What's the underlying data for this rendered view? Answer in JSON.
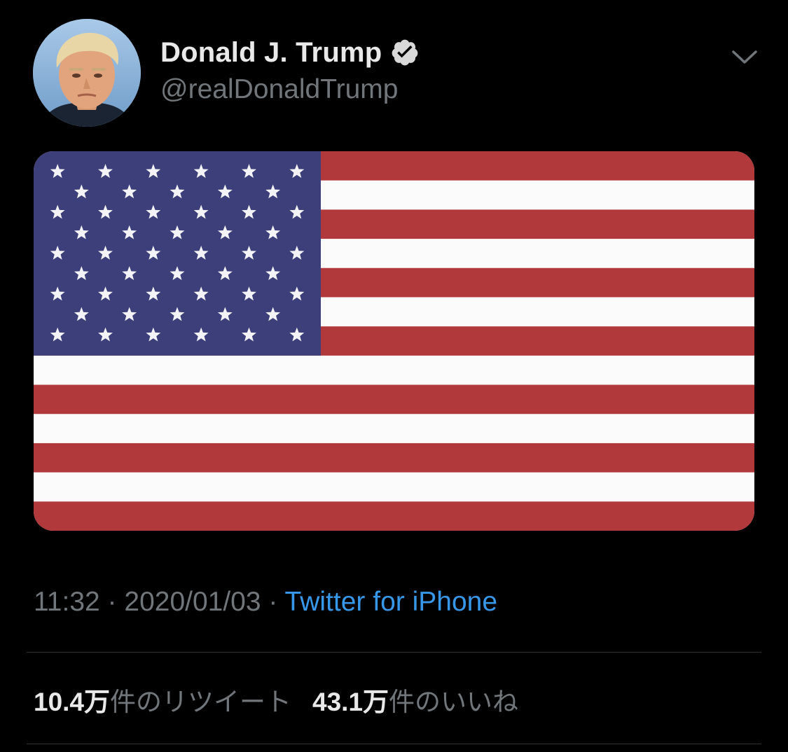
{
  "author": {
    "display_name": "Donald J. Trump",
    "handle": "@realDonaldTrump",
    "verified": true
  },
  "media": {
    "type": "image",
    "subject": "flag"
  },
  "meta": {
    "time": "11:32",
    "separator": " · ",
    "date": "2020/01/03",
    "source": "Twitter for iPhone"
  },
  "stats": {
    "retweets_count": "10.4万",
    "retweets_label": "件のリツイート",
    "likes_count": "43.1万",
    "likes_label": "件のいいね"
  },
  "icons": {
    "verified": "verified-badge-icon",
    "menu": "chevron-down-icon"
  },
  "colors": {
    "background": "#000000",
    "link": "#3797e8",
    "secondary_text": "#71767b",
    "primary_text": "#e9e9ea",
    "divider": "#2f3336"
  }
}
